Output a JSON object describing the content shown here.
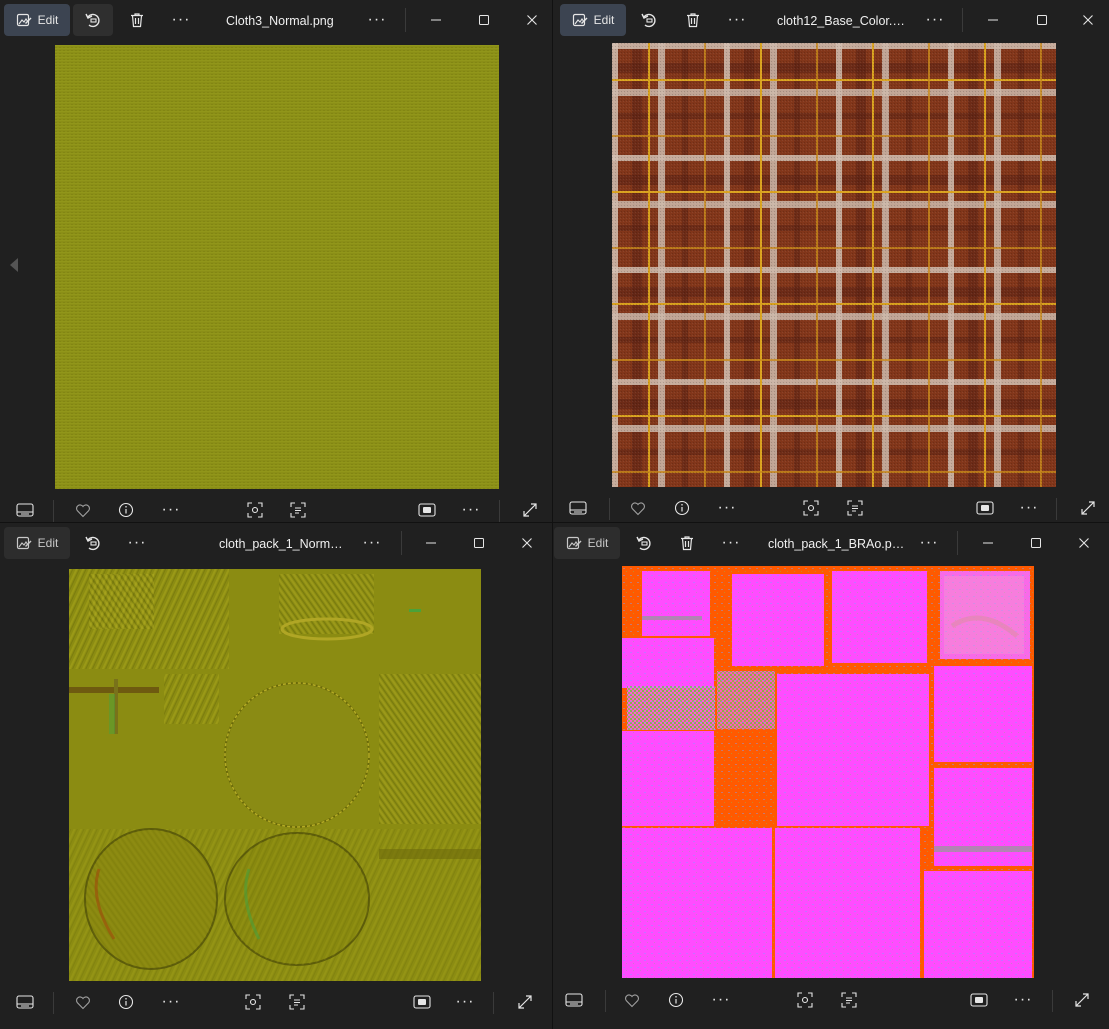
{
  "windows": [
    {
      "title": "Cloth3_Normal.png",
      "edit_label": "Edit"
    },
    {
      "title": "cloth12_Base_Color.…",
      "edit_label": "Edit"
    },
    {
      "title": "cloth_pack_1_Norm…",
      "edit_label": "Edit"
    },
    {
      "title": "cloth_pack_1_BRAo.p…",
      "edit_label": "Edit"
    }
  ],
  "icons": {
    "edit": "edit-image-icon",
    "rotate": "rotate-icon",
    "delete": "trash-icon",
    "more": "more-icon",
    "minimize": "minimize-icon",
    "maximize": "maximize-icon",
    "close": "close-icon",
    "filmstrip": "filmstrip-icon",
    "favorite": "heart-icon",
    "info": "info-icon",
    "visual_search": "visual-search-icon",
    "text_scan": "text-scan-icon",
    "fit": "fit-to-window-icon",
    "fullscreen": "fullscreen-icon",
    "previous": "previous-arrow-icon"
  },
  "colors": {
    "window_bg": "#202020",
    "edit_active": "#3c4451",
    "normal_map": "#8a8f16",
    "plaid_red": "#8a3a1c",
    "brao_magenta": "#ff4cff",
    "brao_orange": "#ff5a00"
  }
}
